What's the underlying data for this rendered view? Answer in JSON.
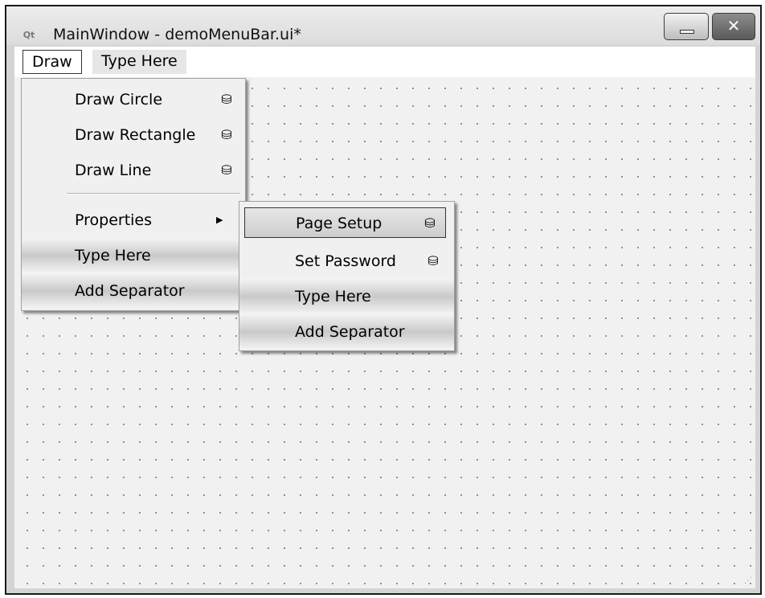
{
  "window": {
    "title": "MainWindow - demoMenuBar.ui*",
    "app_icon": "Qt",
    "minimize_label": "—",
    "close_label": "✕"
  },
  "menubar": {
    "items": [
      {
        "label": "Draw"
      },
      {
        "label": "Type Here"
      }
    ]
  },
  "draw_menu": {
    "items": [
      {
        "label": "Draw Circle",
        "icon": "action-editor-icon"
      },
      {
        "label": "Draw Rectangle",
        "icon": "action-editor-icon"
      },
      {
        "label": "Draw Line",
        "icon": "action-editor-icon"
      },
      {
        "label": "Properties",
        "submenu": true
      },
      {
        "label": "Type Here"
      },
      {
        "label": "Add Separator"
      }
    ]
  },
  "properties_menu": {
    "items": [
      {
        "label": "Page Setup",
        "icon": "action-editor-icon",
        "highlighted": true
      },
      {
        "label": "Set Password",
        "icon": "action-editor-icon"
      },
      {
        "label": "Type Here"
      },
      {
        "label": "Add Separator"
      }
    ]
  },
  "icons": {
    "action_glyph": "⛁",
    "submenu_arrow": "▶",
    "size_grip": "⋰"
  },
  "colors": {
    "canvas_bg": "#f1f1f1",
    "grid_dot": "#7d7d7d",
    "menu_bg": "#f0f0f0"
  }
}
